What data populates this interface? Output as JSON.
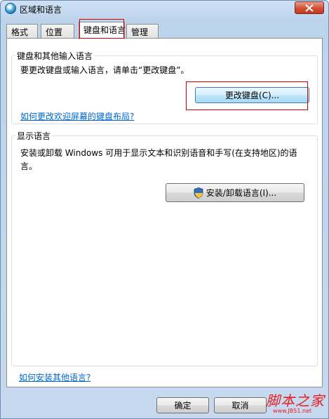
{
  "window": {
    "title": "区域和语言",
    "icon": "globe-icon",
    "close_icon": "close-icon"
  },
  "tabs": [
    {
      "label": "格式",
      "active": false
    },
    {
      "label": "位置",
      "active": false
    },
    {
      "label": "键盘和语言",
      "active": true
    },
    {
      "label": "管理",
      "active": false
    }
  ],
  "keyboard_group": {
    "title": "键盘和其他输入语言",
    "description": "要更改键盘或输入语言，请单击“更改键盘”。",
    "change_button": "更改键盘(C)...",
    "link": "如何更改欢迎屏幕的键盘布局?"
  },
  "display_group": {
    "title": "显示语言",
    "description": "安装或卸载 Windows 可用于显示文本和识别语音和手写(在支持地区)的语言。",
    "install_button": "安装/卸载语言(I)...",
    "install_icon": "shield-icon"
  },
  "bottom_link": "如何安装其他语言?",
  "footer": {
    "ok_button": "确定",
    "cancel_button": "取消"
  },
  "watermark": {
    "logo_text": "脚本之家",
    "url": "www.JB51.net"
  },
  "colors": {
    "highlight_red": "#d40000",
    "link_blue": "#0066cc"
  }
}
